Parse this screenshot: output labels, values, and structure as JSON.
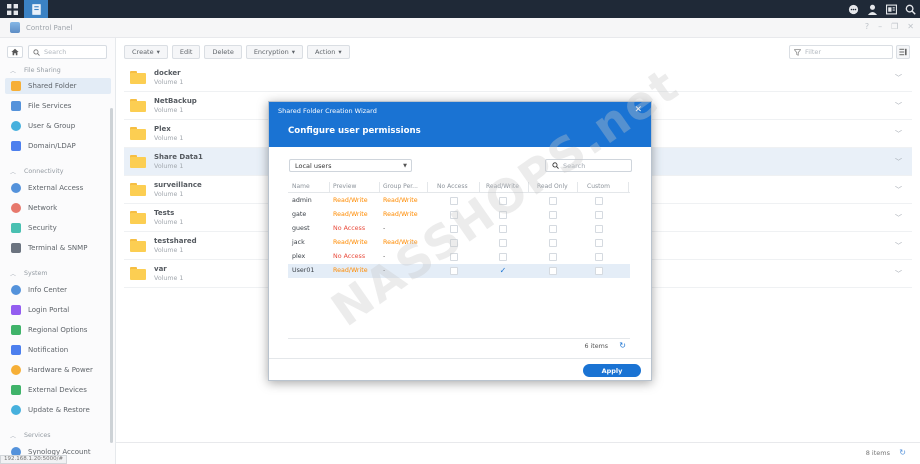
{
  "taskbar": {
    "left_icons": [
      "grid-icon",
      "control-panel-icon"
    ],
    "right_icons": [
      "chat-icon",
      "user-icon",
      "widgets-icon",
      "search-icon"
    ]
  },
  "window": {
    "title": "Control Panel",
    "controls": [
      "?",
      "–",
      "❐",
      "✕"
    ]
  },
  "sidebar": {
    "search_placeholder": "Search",
    "sections": [
      {
        "label": "File Sharing",
        "items": [
          "Shared Folder",
          "File Services",
          "User & Group",
          "Domain/LDAP"
        ]
      },
      {
        "label": "Connectivity",
        "items": [
          "External Access",
          "Network",
          "Security",
          "Terminal & SNMP"
        ]
      },
      {
        "label": "System",
        "items": [
          "Info Center",
          "Login Portal",
          "Regional Options",
          "Notification",
          "Hardware & Power",
          "External Devices",
          "Update & Restore"
        ]
      },
      {
        "label": "Services",
        "items": [
          "Synology Account"
        ]
      }
    ],
    "selected": "Shared Folder",
    "status_url": "192.168.1.20:5000/#"
  },
  "toolbar": {
    "create": "Create",
    "edit": "Edit",
    "delete": "Delete",
    "encryption": "Encryption",
    "action": "Action",
    "filter_placeholder": "Filter"
  },
  "folders": [
    {
      "name": "docker",
      "volume": "Volume 1"
    },
    {
      "name": "NetBackup",
      "volume": "Volume 1"
    },
    {
      "name": "Plex",
      "volume": "Volume 1"
    },
    {
      "name": "Share Data1",
      "volume": "Volume 1",
      "selected": true
    },
    {
      "name": "surveillance",
      "volume": "Volume 1"
    },
    {
      "name": "Tests",
      "volume": "Volume 1"
    },
    {
      "name": "testshared",
      "volume": "Volume 1"
    },
    {
      "name": "var",
      "volume": "Volume 1"
    }
  ],
  "footer": {
    "count": "8 items"
  },
  "wizard": {
    "caption": "Shared Folder Creation Wizard",
    "heading": "Configure user permissions",
    "user_type": "Local users",
    "search_placeholder": "Search",
    "columns": [
      "Name",
      "Preview",
      "Group Per...",
      "No Access",
      "Read/Write",
      "Read Only",
      "Custom"
    ],
    "rows": [
      {
        "name": "admin",
        "preview": "Read/Write",
        "group": "Read/Write",
        "checked": ""
      },
      {
        "name": "gate",
        "preview": "Read/Write",
        "group": "Read/Write",
        "checked": ""
      },
      {
        "name": "guest",
        "preview": "No Access",
        "group": "-",
        "checked": ""
      },
      {
        "name": "jack",
        "preview": "Read/Write",
        "group": "Read/Write",
        "checked": ""
      },
      {
        "name": "plex",
        "preview": "No Access",
        "group": "-",
        "checked": ""
      },
      {
        "name": "User01",
        "preview": "Read/Write",
        "group": "-",
        "checked": "Read/Write",
        "selected": true
      }
    ],
    "item_count": "6 items",
    "apply": "Apply"
  },
  "watermark": "NASSHOPS.net",
  "colors": {
    "accent": "#1a73d3",
    "read_write": "#ff8b00",
    "no_access": "#e94b3c",
    "folder": "#fcc42c"
  }
}
